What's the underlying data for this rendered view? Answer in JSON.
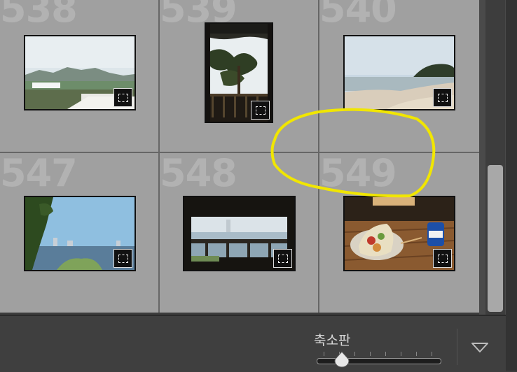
{
  "grid": {
    "cells": [
      {
        "number": "538",
        "shape": "landscape",
        "thumb_desc": "hills-landscape"
      },
      {
        "number": "539",
        "shape": "portrait",
        "thumb_desc": "pavilion-pine"
      },
      {
        "number": "540",
        "shape": "landscape",
        "thumb_desc": "beach"
      },
      {
        "number": "547",
        "shape": "landscape",
        "thumb_desc": "river-trees"
      },
      {
        "number": "548",
        "shape": "landscape",
        "thumb_desc": "window-view"
      },
      {
        "number": "549",
        "shape": "landscape",
        "thumb_desc": "food-table"
      }
    ],
    "badge_icon": "crop-frame-icon"
  },
  "toolbar": {
    "thumbnail_slider_label": "축소판",
    "thumbnail_slider_value": 0.2,
    "dropdown_icon": "triangle-down-icon"
  },
  "colors": {
    "cell_bg": "#a0a0a0",
    "annotation": "#f1e600"
  }
}
